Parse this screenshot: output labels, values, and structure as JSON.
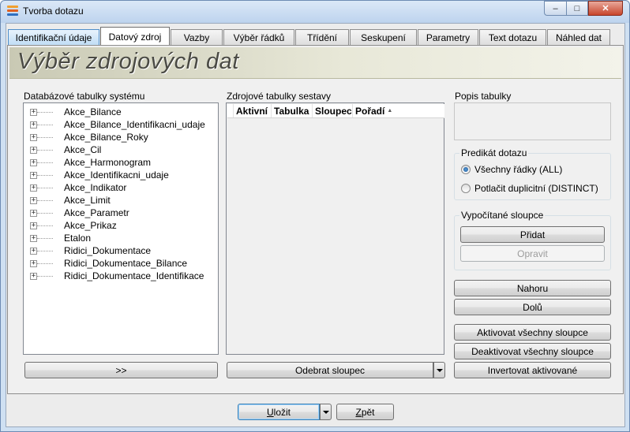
{
  "window": {
    "title": "Tvorba dotazu",
    "controls": {
      "minimize": "‒",
      "maximize": "□",
      "close": "✕"
    }
  },
  "tabs": [
    {
      "label": "Identifikační údaje"
    },
    {
      "label": "Datový zdroj"
    },
    {
      "label": "Vazby"
    },
    {
      "label": "Výběr řádků"
    },
    {
      "label": "Třídění"
    },
    {
      "label": "Seskupení"
    },
    {
      "label": "Parametry"
    },
    {
      "label": "Text dotazu"
    },
    {
      "label": "Náhled dat"
    }
  ],
  "active_tab": "Datový zdroj",
  "banner": {
    "title": "Výběr zdrojových dat"
  },
  "system_tables": {
    "label": "Databázové tabulky systému",
    "items": [
      "Akce_Bilance",
      "Akce_Bilance_Identifikacni_udaje",
      "Akce_Bilance_Roky",
      "Akce_Cil",
      "Akce_Harmonogram",
      "Akce_Identifikacni_udaje",
      "Akce_Indikator",
      "Akce_Limit",
      "Akce_Parametr",
      "Akce_Prikaz",
      "Etalon",
      "Ridici_Dokumentace",
      "Ridici_Dokumentace_Bilance",
      "Ridici_Dokumentace_Identifikace"
    ],
    "expander_symbol": "+",
    "add_button": ">>"
  },
  "source_tables": {
    "label": "Zdrojové tabulky sestavy",
    "columns": [
      "Aktivní",
      "Tabulka",
      "Sloupec",
      "Pořadí"
    ],
    "sort_indicator": "▲",
    "remove_button": "Odebrat sloupec"
  },
  "table_description": {
    "label": "Popis tabulky",
    "value": ""
  },
  "predicate": {
    "label": "Predikát dotazu",
    "options": [
      {
        "label": "Všechny řádky (ALL)",
        "checked": true
      },
      {
        "label": "Potlačit duplicitní (DISTINCT)",
        "checked": false
      }
    ]
  },
  "computed_columns": {
    "label": "Vypočítané sloupce",
    "add_button": "Přidat",
    "edit_button": "Opravit"
  },
  "buttons": {
    "up": "Nahoru",
    "down": "Dolů",
    "activate_all": "Aktivovat všechny sloupce",
    "deactivate_all": "Deaktivovat všechny sloupce",
    "invert": "Invertovat aktivované"
  },
  "footer": {
    "save_first": "U",
    "save_rest": "ložit",
    "back_first": "Z",
    "back_rest": "pět"
  },
  "colors": {
    "title_bar": "#c4d8f0",
    "close_button": "#c8452c",
    "banner_text": "#4a4a44",
    "active_tab_border": "#4f8ec9",
    "icon_stripes": [
      "#f0a030",
      "#e06020",
      "#3070c0"
    ]
  }
}
